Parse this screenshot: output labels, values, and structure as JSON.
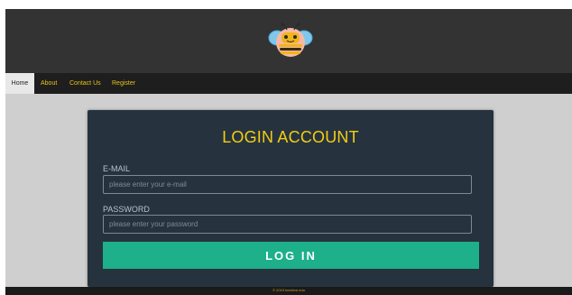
{
  "nav": {
    "items": [
      {
        "label": "Home"
      },
      {
        "label": "About"
      },
      {
        "label": "Contact Us"
      },
      {
        "label": "Register"
      }
    ]
  },
  "login": {
    "title": "LOGIN ACCOUNT",
    "email_label": "E-MAIL",
    "email_placeholder": "please enter your e-mail",
    "password_label": "PASSWORD",
    "password_placeholder": "please enter your password",
    "button_label": "LOG IN"
  },
  "footer": {
    "text": "© 2019 beehive.edu"
  },
  "colors": {
    "header_bg": "#333333",
    "nav_bg": "#1e1e1e",
    "nav_text": "#e8c21a",
    "card_bg": "#26333f",
    "title": "#f2cd13",
    "button": "#1db08a",
    "page_bg": "#cfcfcf"
  },
  "icons": {
    "logo": "bee-icon"
  }
}
